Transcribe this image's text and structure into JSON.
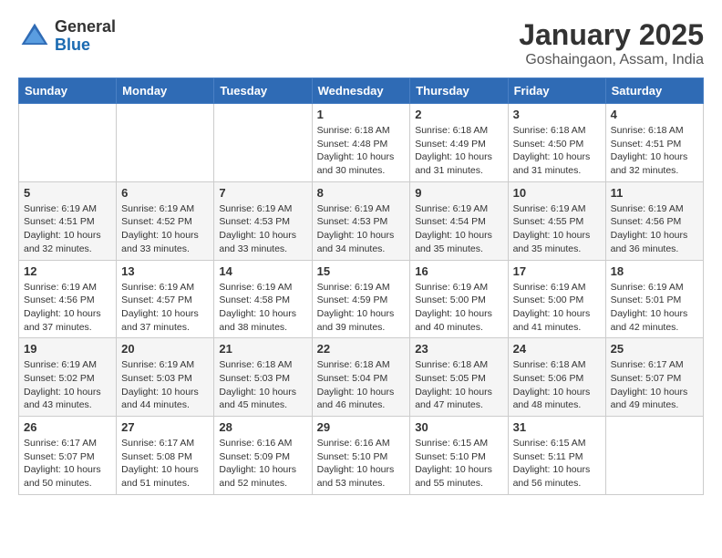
{
  "header": {
    "logo_line1": "General",
    "logo_line2": "Blue",
    "month_title": "January 2025",
    "location": "Goshaingaon, Assam, India"
  },
  "weekdays": [
    "Sunday",
    "Monday",
    "Tuesday",
    "Wednesday",
    "Thursday",
    "Friday",
    "Saturday"
  ],
  "weeks": [
    [
      {
        "num": "",
        "info": ""
      },
      {
        "num": "",
        "info": ""
      },
      {
        "num": "",
        "info": ""
      },
      {
        "num": "1",
        "info": "Sunrise: 6:18 AM\nSunset: 4:48 PM\nDaylight: 10 hours\nand 30 minutes."
      },
      {
        "num": "2",
        "info": "Sunrise: 6:18 AM\nSunset: 4:49 PM\nDaylight: 10 hours\nand 31 minutes."
      },
      {
        "num": "3",
        "info": "Sunrise: 6:18 AM\nSunset: 4:50 PM\nDaylight: 10 hours\nand 31 minutes."
      },
      {
        "num": "4",
        "info": "Sunrise: 6:18 AM\nSunset: 4:51 PM\nDaylight: 10 hours\nand 32 minutes."
      }
    ],
    [
      {
        "num": "5",
        "info": "Sunrise: 6:19 AM\nSunset: 4:51 PM\nDaylight: 10 hours\nand 32 minutes."
      },
      {
        "num": "6",
        "info": "Sunrise: 6:19 AM\nSunset: 4:52 PM\nDaylight: 10 hours\nand 33 minutes."
      },
      {
        "num": "7",
        "info": "Sunrise: 6:19 AM\nSunset: 4:53 PM\nDaylight: 10 hours\nand 33 minutes."
      },
      {
        "num": "8",
        "info": "Sunrise: 6:19 AM\nSunset: 4:53 PM\nDaylight: 10 hours\nand 34 minutes."
      },
      {
        "num": "9",
        "info": "Sunrise: 6:19 AM\nSunset: 4:54 PM\nDaylight: 10 hours\nand 35 minutes."
      },
      {
        "num": "10",
        "info": "Sunrise: 6:19 AM\nSunset: 4:55 PM\nDaylight: 10 hours\nand 35 minutes."
      },
      {
        "num": "11",
        "info": "Sunrise: 6:19 AM\nSunset: 4:56 PM\nDaylight: 10 hours\nand 36 minutes."
      }
    ],
    [
      {
        "num": "12",
        "info": "Sunrise: 6:19 AM\nSunset: 4:56 PM\nDaylight: 10 hours\nand 37 minutes."
      },
      {
        "num": "13",
        "info": "Sunrise: 6:19 AM\nSunset: 4:57 PM\nDaylight: 10 hours\nand 37 minutes."
      },
      {
        "num": "14",
        "info": "Sunrise: 6:19 AM\nSunset: 4:58 PM\nDaylight: 10 hours\nand 38 minutes."
      },
      {
        "num": "15",
        "info": "Sunrise: 6:19 AM\nSunset: 4:59 PM\nDaylight: 10 hours\nand 39 minutes."
      },
      {
        "num": "16",
        "info": "Sunrise: 6:19 AM\nSunset: 5:00 PM\nDaylight: 10 hours\nand 40 minutes."
      },
      {
        "num": "17",
        "info": "Sunrise: 6:19 AM\nSunset: 5:00 PM\nDaylight: 10 hours\nand 41 minutes."
      },
      {
        "num": "18",
        "info": "Sunrise: 6:19 AM\nSunset: 5:01 PM\nDaylight: 10 hours\nand 42 minutes."
      }
    ],
    [
      {
        "num": "19",
        "info": "Sunrise: 6:19 AM\nSunset: 5:02 PM\nDaylight: 10 hours\nand 43 minutes."
      },
      {
        "num": "20",
        "info": "Sunrise: 6:19 AM\nSunset: 5:03 PM\nDaylight: 10 hours\nand 44 minutes."
      },
      {
        "num": "21",
        "info": "Sunrise: 6:18 AM\nSunset: 5:03 PM\nDaylight: 10 hours\nand 45 minutes."
      },
      {
        "num": "22",
        "info": "Sunrise: 6:18 AM\nSunset: 5:04 PM\nDaylight: 10 hours\nand 46 minutes."
      },
      {
        "num": "23",
        "info": "Sunrise: 6:18 AM\nSunset: 5:05 PM\nDaylight: 10 hours\nand 47 minutes."
      },
      {
        "num": "24",
        "info": "Sunrise: 6:18 AM\nSunset: 5:06 PM\nDaylight: 10 hours\nand 48 minutes."
      },
      {
        "num": "25",
        "info": "Sunrise: 6:17 AM\nSunset: 5:07 PM\nDaylight: 10 hours\nand 49 minutes."
      }
    ],
    [
      {
        "num": "26",
        "info": "Sunrise: 6:17 AM\nSunset: 5:07 PM\nDaylight: 10 hours\nand 50 minutes."
      },
      {
        "num": "27",
        "info": "Sunrise: 6:17 AM\nSunset: 5:08 PM\nDaylight: 10 hours\nand 51 minutes."
      },
      {
        "num": "28",
        "info": "Sunrise: 6:16 AM\nSunset: 5:09 PM\nDaylight: 10 hours\nand 52 minutes."
      },
      {
        "num": "29",
        "info": "Sunrise: 6:16 AM\nSunset: 5:10 PM\nDaylight: 10 hours\nand 53 minutes."
      },
      {
        "num": "30",
        "info": "Sunrise: 6:15 AM\nSunset: 5:10 PM\nDaylight: 10 hours\nand 55 minutes."
      },
      {
        "num": "31",
        "info": "Sunrise: 6:15 AM\nSunset: 5:11 PM\nDaylight: 10 hours\nand 56 minutes."
      },
      {
        "num": "",
        "info": ""
      }
    ]
  ]
}
